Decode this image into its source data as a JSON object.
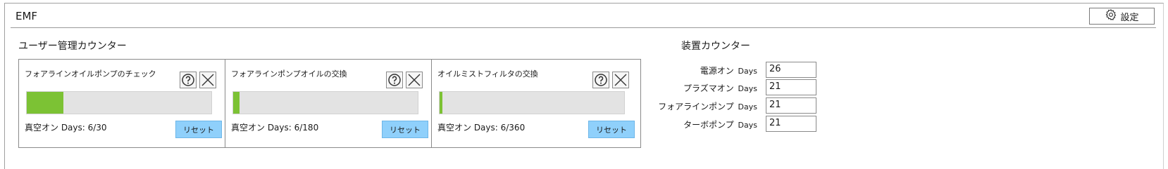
{
  "header": {
    "title": "EMF",
    "settings_label": "設定",
    "settings_icon": "gear-icon"
  },
  "user_counters": {
    "title": "ユーザー管理カウンター",
    "cards": [
      {
        "title": "フォアラインオイルポンプのチェック",
        "days_text": "真空オン Days: 6/30",
        "current": 6,
        "max": 30,
        "reset_label": "リセット"
      },
      {
        "title": "フォアラインポンプオイルの交換",
        "days_text": "真空オン Days: 6/180",
        "current": 6,
        "max": 180,
        "reset_label": "リセット"
      },
      {
        "title": "オイルミストフィルタの交換",
        "days_text": "真空オン Days: 6/360",
        "current": 6,
        "max": 360,
        "reset_label": "リセット"
      }
    ]
  },
  "device_counters": {
    "title": "装置カウンター",
    "rows": [
      {
        "label": "電源オン",
        "unit": "Days",
        "value": "26"
      },
      {
        "label": "プラズマオン",
        "unit": "Days",
        "value": "21"
      },
      {
        "label": "フォアラインポンプ",
        "unit": "Days",
        "value": "21"
      },
      {
        "label": "ターボポンプ",
        "unit": "Days",
        "value": "21"
      }
    ]
  },
  "colors": {
    "progress_fill": "#7cc234",
    "progress_track": "#e3e3e3",
    "reset_button": "#8fd0fb"
  }
}
